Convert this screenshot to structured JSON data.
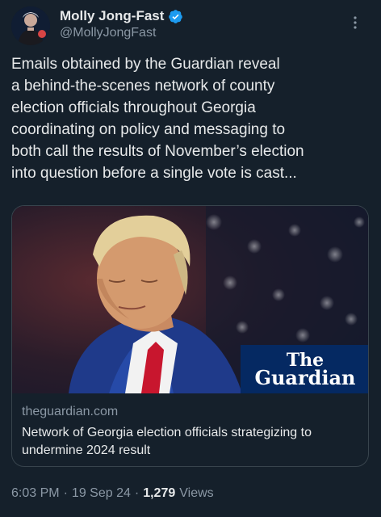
{
  "author": {
    "display_name": "Molly Jong-Fast",
    "handle": "@MollyJongFast",
    "verified": true,
    "avatar_icon": "profile-photo"
  },
  "tweet": {
    "text": "Emails obtained by the Guardian reveal\na behind-the-scenes network of county\nelection officials throughout Georgia\ncoordinating on policy and messaging to\nboth call the results of November’s election\ninto question before a single vote is cast..."
  },
  "card": {
    "domain": "theguardian.com",
    "title": "Network of Georgia election officials strategizing to undermine 2024 result",
    "badge_line1": "The",
    "badge_line2": "Guardian"
  },
  "meta": {
    "time": "6:03 PM",
    "separator": "·",
    "date": "19 Sep 24",
    "views_count": "1,279",
    "views_label": "Views"
  },
  "colors": {
    "background": "#15202b",
    "verified_badge": "#1d9bf0",
    "guardian_blue": "#052962",
    "muted_text": "#8b98a5"
  }
}
